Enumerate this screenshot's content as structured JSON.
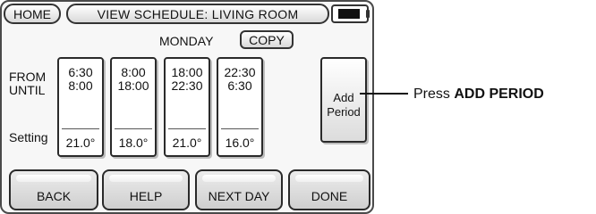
{
  "header": {
    "home_label": "HOME",
    "title": "VIEW SCHEDULE: LIVING ROOM",
    "battery_icon": "battery-icon"
  },
  "day": {
    "name": "MONDAY",
    "copy_label": "COPY"
  },
  "labels": {
    "from": "FROM",
    "until": "UNTIL",
    "setting": "Setting"
  },
  "periods": [
    {
      "from": "6:30",
      "until": "8:00",
      "setting": "21.0°"
    },
    {
      "from": "8:00",
      "until": "18:00",
      "setting": "18.0°"
    },
    {
      "from": "18:00",
      "until": "22:30",
      "setting": "21.0°"
    },
    {
      "from": "22:30",
      "until": "6:30",
      "setting": "16.0°"
    }
  ],
  "add_period": {
    "line1": "Add",
    "line2": "Period"
  },
  "callout": {
    "prefix": "Press ",
    "bold": "ADD PERIOD"
  },
  "nav": {
    "back": "BACK",
    "help": "HELP",
    "next_day": "NEXT DAY",
    "done": "DONE"
  }
}
